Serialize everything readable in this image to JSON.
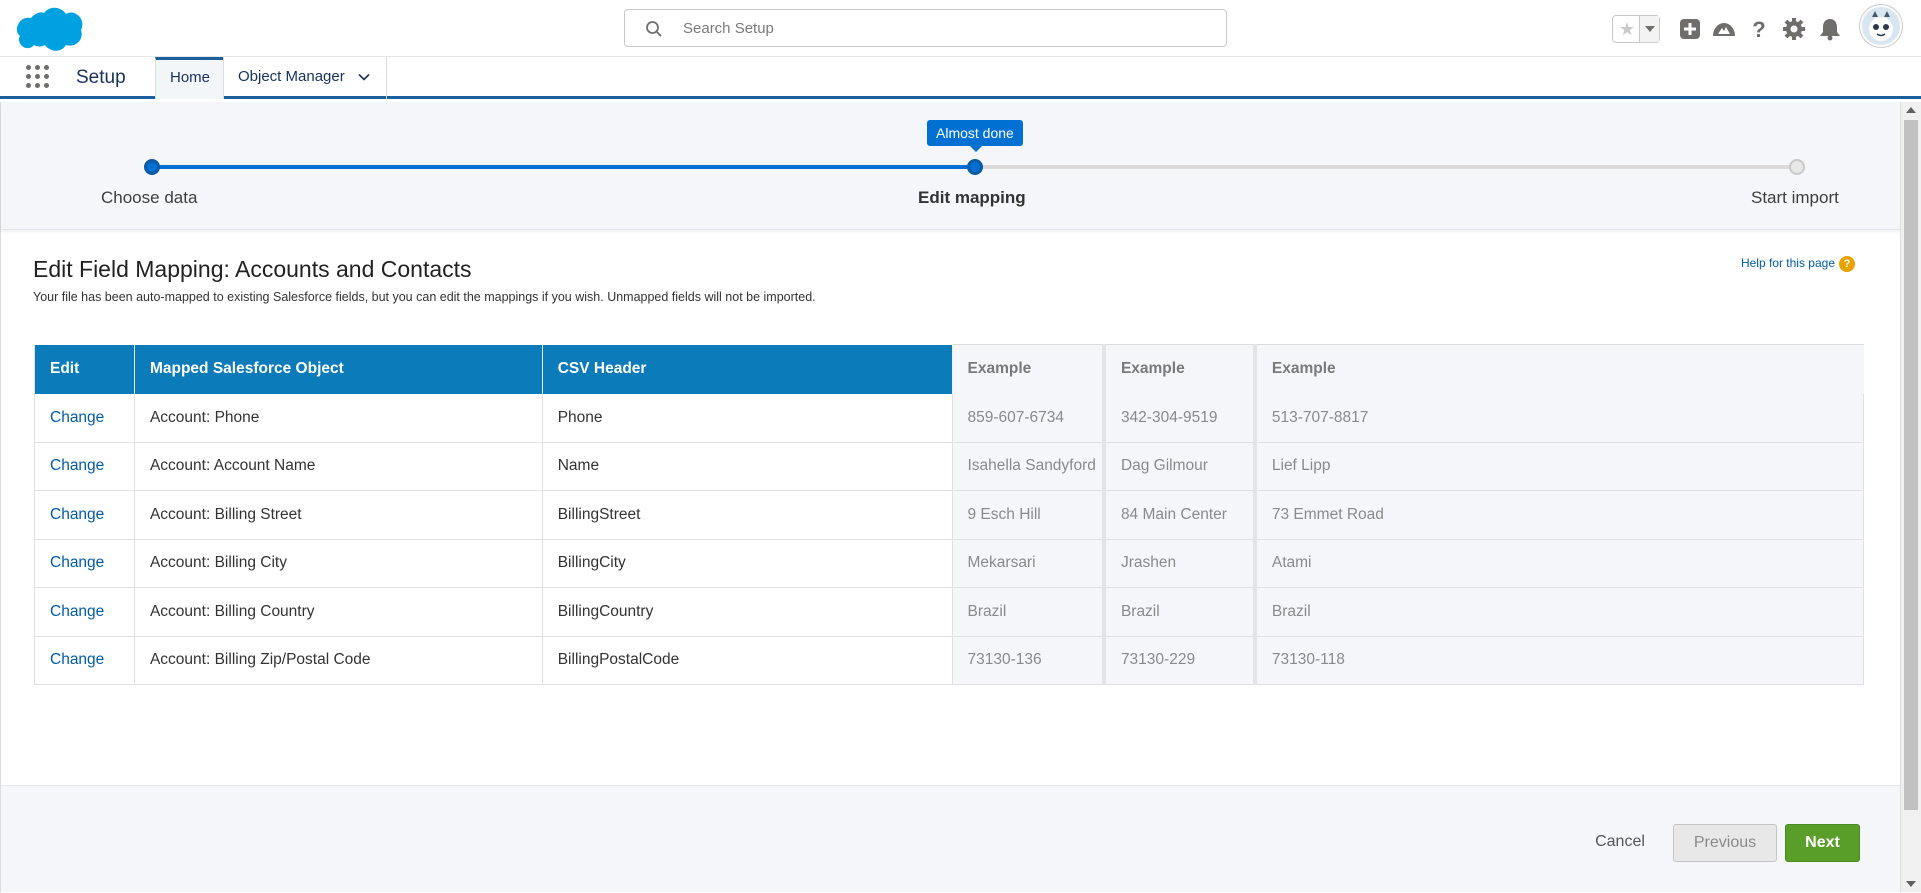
{
  "header": {
    "search_placeholder": "Search Setup",
    "brand_color": "#00a1e0",
    "icons": [
      "favorites-star-icon",
      "favorites-dropdown-icon",
      "global-actions-add-icon",
      "trailhead-icon",
      "help-icon",
      "setup-gear-icon",
      "notifications-bell-icon",
      "user-avatar"
    ]
  },
  "nav": {
    "app_name": "Setup",
    "tabs": [
      {
        "label": "Home"
      },
      {
        "label": "Object Manager"
      }
    ]
  },
  "progress": {
    "tooltip": "Almost done",
    "steps": [
      {
        "label": "Choose data"
      },
      {
        "label": "Edit mapping"
      },
      {
        "label": "Start import"
      }
    ],
    "current_step": 2
  },
  "page": {
    "title": "Edit Field Mapping: Accounts and Contacts",
    "help_link": "Help for this page",
    "help_icon": "?",
    "description": "Your file has been auto-mapped to existing Salesforce fields, but you can edit the mappings if you wish. Unmapped fields will not be imported."
  },
  "table": {
    "headers": [
      "Edit",
      "Mapped Salesforce Object",
      "CSV Header",
      "Example",
      "Example",
      "Example"
    ],
    "rows": [
      {
        "edit": "Change",
        "object": "Account: Phone",
        "csv": "Phone",
        "ex1": "859-607-6734",
        "ex2": "342-304-9519",
        "ex3": "513-707-8817"
      },
      {
        "edit": "Change",
        "object": "Account: Account Name",
        "csv": "Name",
        "ex1": "Isahella Sandyford",
        "ex2": "Dag Gilmour",
        "ex3": "Lief Lipp"
      },
      {
        "edit": "Change",
        "object": "Account: Billing Street",
        "csv": "BillingStreet",
        "ex1": "9 Esch Hill",
        "ex2": "84 Main Center",
        "ex3": "73 Emmet Road"
      },
      {
        "edit": "Change",
        "object": "Account: Billing City",
        "csv": "BillingCity",
        "ex1": "Mekarsari",
        "ex2": "Jrashen",
        "ex3": "Atami"
      },
      {
        "edit": "Change",
        "object": "Account: Billing Country",
        "csv": "BillingCountry",
        "ex1": "Brazil",
        "ex2": "Brazil",
        "ex3": "Brazil"
      },
      {
        "edit": "Change",
        "object": "Account: Billing Zip/Postal Code",
        "csv": "BillingPostalCode",
        "ex1": "73130-136",
        "ex2": "73130-229",
        "ex3": "73130-118"
      }
    ]
  },
  "footer": {
    "cancel": "Cancel",
    "previous": "Previous",
    "next": "Next"
  }
}
